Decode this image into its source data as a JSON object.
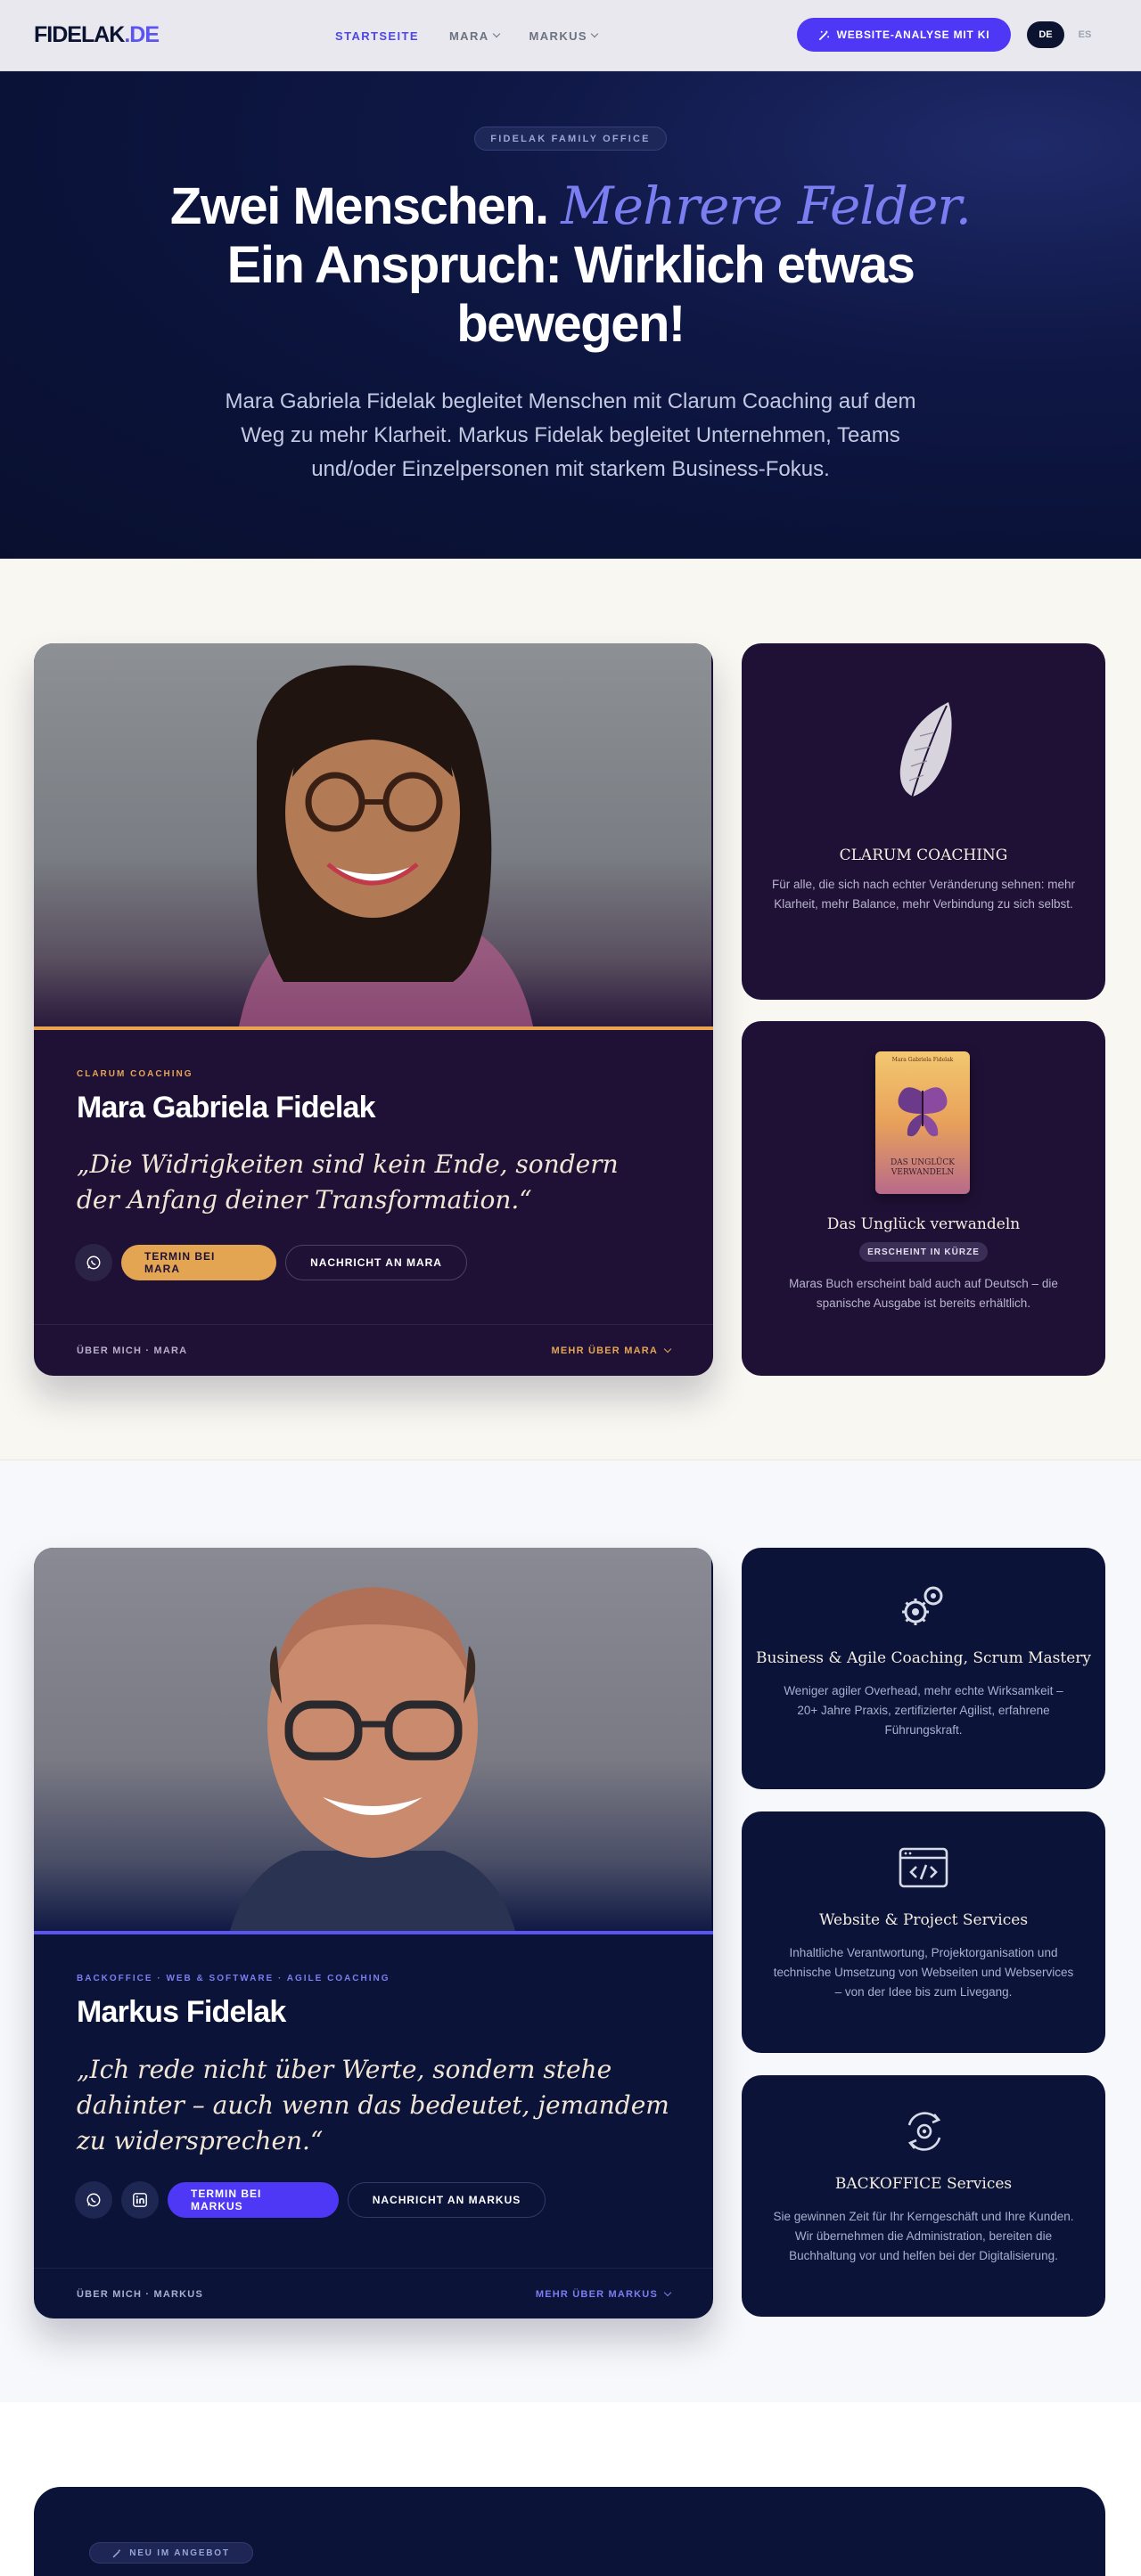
{
  "nav": {
    "logo_main": "FIDELAK",
    "logo_tld": ".DE",
    "links": [
      {
        "label": "STARTSEITE",
        "active": true,
        "dropdown": false
      },
      {
        "label": "MARA",
        "active": false,
        "dropdown": true
      },
      {
        "label": "MARKUS",
        "active": false,
        "dropdown": true
      }
    ],
    "cta_label": "WEBSITE-ANALYSE MIT KI",
    "languages": [
      {
        "label": "DE",
        "active": true
      },
      {
        "label": "ES",
        "active": false
      }
    ]
  },
  "hero": {
    "badge": "FIDELAK FAMILY OFFICE",
    "title_part1": "Zwei Menschen.",
    "title_accent": "Mehrere Felder.",
    "title_part2": "Ein Anspruch: Wirklich etwas bewegen!",
    "subtitle": "Mara Gabriela Fidelak begleitet Menschen mit Clarum Coaching auf dem Weg zu mehr Klarheit. Markus Fidelak begleitet Unternehmen, Teams und/oder Einzelpersonen mit starkem Business-Fokus."
  },
  "mara": {
    "eyebrow": "CLARUM COACHING",
    "name": "Mara Gabriela Fidelak",
    "quote": "„Die Widrigkeiten sind kein Ende, sondern der Anfang deiner Transformation.“",
    "btn_termin": "TERMIN BEI MARA",
    "btn_nachricht": "NACHRICHT AN MARA",
    "footer_left": "ÜBER MICH · MARA",
    "footer_right": "MEHR ÜBER MARA",
    "accent_color": "#e4a553"
  },
  "mara_side": [
    {
      "title": "CLARUM COACHING",
      "text": "Für alle, die sich nach echter Veränderung sehnen: mehr Klarheit, mehr Balance, mehr Verbindung zu sich selbst.",
      "icon": "leaf-icon"
    },
    {
      "title": "Das Unglück verwandeln",
      "pill": "ERSCHEINT IN KÜRZE",
      "text": "Maras Buch erscheint bald auch auf Deutsch – die spanische Ausgabe ist bereits erhältlich.",
      "icon": "book-cover",
      "book_text": "DAS UNGLÜCK VERWANDELN",
      "book_author": "Mara Gabriela Fidelak"
    }
  ],
  "markus": {
    "eyebrow": "BACKOFFICE · WEB & SOFTWARE · AGILE COACHING",
    "name": "Markus Fidelak",
    "quote": "„Ich rede nicht über Werte, sondern stehe dahinter – auch wenn das bedeutet, jemandem zu widersprechen.“",
    "btn_termin": "TERMIN BEI MARKUS",
    "btn_nachricht": "NACHRICHT AN MARKUS",
    "footer_left": "ÜBER MICH · MARKUS",
    "footer_right": "MEHR ÜBER MARKUS",
    "accent_color": "#5b54f0"
  },
  "markus_side": [
    {
      "title": "Business & Agile Coaching, Scrum Mastery",
      "text": "Weniger agiler Overhead, mehr echte Wirksamkeit – 20+ Jahre Praxis, zertifizierter Agilist, erfahrene Führungskraft.",
      "icon": "gears-icon"
    },
    {
      "title": "Website & Project Services",
      "text": "Inhaltliche Verantwortung, Projektorganisation und technische Umsetzung von Webseiten und Webservices – von der Idee bis zum Livegang.",
      "icon": "code-window-icon"
    },
    {
      "title": "BACKOFFICE Services",
      "text": "Sie gewinnen Zeit für Ihr Kerngeschäft und Ihre Kunden. Wir übernehmen die Administration, bereiten die Buchhaltung vor und helfen bei der Digitalisierung.",
      "icon": "cycle-gear-icon"
    }
  ],
  "bottom": {
    "badge": "NEU IM ANGEBOT"
  }
}
